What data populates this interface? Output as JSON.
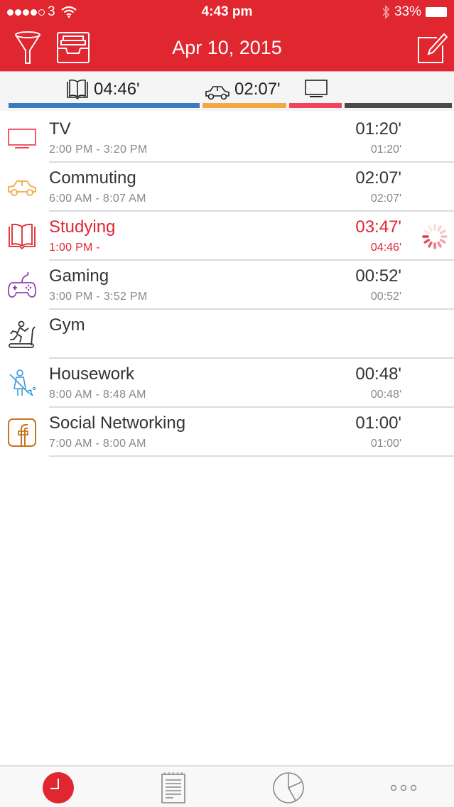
{
  "status_bar": {
    "signal_dots_filled": 4,
    "signal_dots_total": 5,
    "carrier": "3",
    "time": "4:43 pm",
    "battery": "33%",
    "icons": [
      "wifi-icon",
      "bluetooth-icon",
      "battery-icon"
    ]
  },
  "nav": {
    "title": "Apr 10, 2015",
    "left_buttons": [
      {
        "name": "filter",
        "icon": "funnel-icon"
      },
      {
        "name": "archive",
        "icon": "inbox-tray-icon"
      }
    ],
    "right_button": {
      "name": "edit",
      "icon": "compose-icon"
    }
  },
  "summary": {
    "items": [
      {
        "icon": "book-icon",
        "label": "04:46'"
      },
      {
        "icon": "car-icon",
        "label": "02:07'"
      },
      {
        "icon": "tv-icon",
        "label": ""
      }
    ],
    "bars": [
      {
        "category": "Studying",
        "color": "#3a7bbf",
        "fraction": 0.44
      },
      {
        "category": "Commuting",
        "color": "#f5a742",
        "fraction": 0.19
      },
      {
        "category": "TV",
        "color": "#f3455a",
        "fraction": 0.12
      },
      {
        "category": "Other",
        "color": "#4a4a4a",
        "fraction": 0.25
      }
    ]
  },
  "activities": [
    {
      "name": "TV",
      "range": "2:00 PM - 3:20 PM",
      "duration": "01:20'",
      "total": "01:20'",
      "icon": "tv-icon",
      "color": "#f3455a",
      "active": false
    },
    {
      "name": "Commuting",
      "range": "6:00 AM - 8:07 AM",
      "duration": "02:07'",
      "total": "02:07'",
      "icon": "car-icon",
      "color": "#f5a742",
      "active": false
    },
    {
      "name": "Studying",
      "range": "1:00 PM -",
      "duration": "03:47'",
      "total": "04:46'",
      "icon": "book-icon",
      "color": "#e0262f",
      "active": true
    },
    {
      "name": "Gaming",
      "range": "3:00 PM - 3:52 PM",
      "duration": "00:52'",
      "total": "00:52'",
      "icon": "gamepad-icon",
      "color": "#8e44ad",
      "active": false
    },
    {
      "name": "Gym",
      "range": "",
      "duration": "",
      "total": "",
      "icon": "treadmill-icon",
      "color": "#333333",
      "active": false
    },
    {
      "name": "Housework",
      "range": "8:00 AM - 8:48 AM",
      "duration": "00:48'",
      "total": "00:48'",
      "icon": "sweeping-icon",
      "color": "#3a9ad9",
      "active": false
    },
    {
      "name": "Social Networking",
      "range": "7:00 AM - 8:00 AM",
      "duration": "01:00'",
      "total": "01:00'",
      "icon": "facebook-icon",
      "color": "#c8741f",
      "active": false
    }
  ],
  "tabbar": {
    "tabs": [
      {
        "name": "clock",
        "icon": "clock-icon",
        "selected": true
      },
      {
        "name": "notes",
        "icon": "notepad-icon",
        "selected": false
      },
      {
        "name": "stats",
        "icon": "pie-chart-icon",
        "selected": false
      },
      {
        "name": "more",
        "icon": "more-icon",
        "selected": false
      }
    ]
  },
  "colors": {
    "brand": "#e0262f",
    "text": "#333333",
    "subtext": "#888888"
  }
}
